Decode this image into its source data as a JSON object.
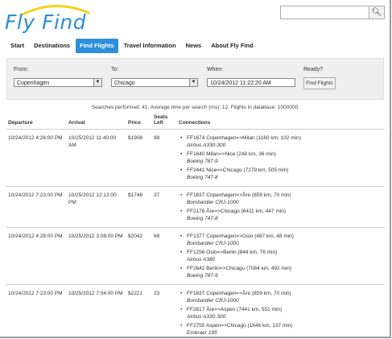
{
  "brand": {
    "name": "Fly Find",
    "accent": "#2d8fd8",
    "logo_arc": "#f2d21a"
  },
  "search": {
    "placeholder": "",
    "icon": "search-icon"
  },
  "nav": {
    "items": [
      {
        "label": "Start"
      },
      {
        "label": "Destinations"
      },
      {
        "label": "Find Flights",
        "active": true
      },
      {
        "label": "Travel Information"
      },
      {
        "label": "News"
      },
      {
        "label": "About Fly Find"
      }
    ]
  },
  "form": {
    "from_label": "From:",
    "from_value": "Copenhagen",
    "to_label": "To:",
    "to_value": "Chicago",
    "when_label": "When:",
    "when_value": "10/24/2012 11:22:20 AM",
    "ready_label": "Ready?",
    "find_button": "Find Flights"
  },
  "stats": "Searches performed: 41. Average time per search (ms): 12. Flights in database: 1000000",
  "table": {
    "headers": {
      "departure": "Departure",
      "arrival": "Arrival",
      "price": "Price",
      "seats": "Seats Left",
      "connections": "Connections"
    },
    "rows": [
      {
        "departure": "10/24/2012 4:26:00 PM",
        "arrival": "10/25/2012 11:40:00 AM",
        "price": "$1908",
        "seats": "98",
        "connections": [
          {
            "flight": "FF1674 Copenhagen=>Milan (1160 km, 102 min)",
            "aircraft": "Airbus A330-300"
          },
          {
            "flight": "FF1640 Milan=>Nice (248 km, 36 min)",
            "aircraft": "Boeing 787-9"
          },
          {
            "flight": "FF2441 Nice=>Chicago (7279 km, 505 min)",
            "aircraft": "Boeing 747-8"
          }
        ]
      },
      {
        "departure": "10/24/2012 7:23:00 PM",
        "arrival": "10/25/2012 12:13:00 PM",
        "price": "$1746",
        "seats": "37",
        "connections": [
          {
            "flight": "FF1837 Copenhagen=>Åre (859 km, 70 min)",
            "aircraft": "Bombardier CRJ-1000"
          },
          {
            "flight": "FF2178 Åre=>Chicago (6411 km, 447 min)",
            "aircraft": "Boeing 747-8"
          }
        ]
      },
      {
        "departure": "10/24/2012 4:28:00 PM",
        "arrival": "10/25/2012 3:08:00 PM",
        "price": "$2042",
        "seats": "68",
        "connections": [
          {
            "flight": "FF1377 Copenhagen=>Oslo (487 km, 48 min)",
            "aircraft": "Bombardier CRJ-1000"
          },
          {
            "flight": "FF1256 Oslo=>Berlin (844 km, 76 min)",
            "aircraft": "Airbus A380"
          },
          {
            "flight": "FF2642 Berlin=>Chicago (7084 km, 492 min)",
            "aircraft": "Boeing 787-9"
          }
        ]
      },
      {
        "departure": "10/24/2012 7:23:00 PM",
        "arrival": "10/25/2012 7:04:00 PM",
        "price": "$2221",
        "seats": "23",
        "connections": [
          {
            "flight": "FF1837 Copenhagen=>Åre (859 km, 70 min)",
            "aircraft": "Bombardier CRJ-1000"
          },
          {
            "flight": "FF2817 Åre=>Aspen (7441 km, 551 min)",
            "aircraft": "Airbus A330-300"
          },
          {
            "flight": "FF2755 Aspen=>Chicago (1646 km, 137 min)",
            "aircraft": "Embraer 195"
          }
        ]
      }
    ]
  }
}
